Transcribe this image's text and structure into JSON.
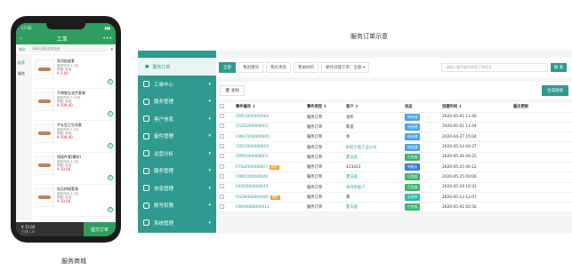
{
  "captions": {
    "left": "服务商城",
    "right": "服务订单示意"
  },
  "phone": {
    "status_time": "17:02",
    "status_right": "▮▮▮",
    "title": "工单",
    "search_tag": "服务",
    "search_placeholder": "请输入服务名称搜索",
    "sidebar": [
      "推荐",
      "服务"
    ],
    "products": [
      {
        "name": "家用插座套",
        "meta1": "服务时间 3-5天",
        "meta2": "规格: 标准",
        "price": "¥ 5.00"
      },
      {
        "name": "不锈钢五金件套装",
        "meta1": "服务时间 7-10天",
        "meta2": "规格: 标准",
        "price": "¥ 599.00"
      },
      {
        "name": "中长型卫生间套",
        "meta1": "服务时间 3-5天",
        "meta2": "规格: 标准",
        "price": "¥ 599.00"
      },
      {
        "name": "锁接件套(螺纹)",
        "meta1": "服务时间 3-5天",
        "meta2": "规格: 标准",
        "price": "¥ 20.00"
      },
      {
        "name": "钻石拼接套装",
        "meta1": "服务时间 3-5天",
        "meta2": "规格: 标准",
        "price": "¥ 50.00"
      }
    ],
    "footer_total": "¥ 15.00",
    "footer_count": "已选 (1)",
    "footer_button": "提交订单"
  },
  "admin": {
    "sidebar_active": "服务订单",
    "nav": [
      {
        "label": "工单中心",
        "icon": "ticket-icon"
      },
      {
        "label": "服务管理",
        "icon": "service-icon"
      },
      {
        "label": "客户信息",
        "icon": "customer-icon"
      },
      {
        "label": "备件管理",
        "icon": "parts-icon"
      },
      {
        "label": "运营分析",
        "icon": "analysis-icon"
      },
      {
        "label": "服务管理",
        "icon": "heart-icon"
      },
      {
        "label": "信息管理",
        "icon": "info-icon"
      },
      {
        "label": "账号权限",
        "icon": "account-icon"
      },
      {
        "label": "系统管理",
        "icon": "settings-icon"
      }
    ],
    "tabs": [
      "全部",
      "我创建的",
      "我负责的",
      "我协同的"
    ],
    "filter_label": "委托创建工单：全部",
    "search_placeholder": "请输入事件编号搜索订单信息",
    "search_button": "搜 索",
    "delete_button": "删除",
    "generate_button": "生成链接",
    "columns": [
      "事件编号 ↕",
      "事件类型 ↕",
      "客户 ↕",
      "状态",
      "创建时间 ↕",
      "最近更新"
    ],
    "rows": [
      {
        "id": "CMR1000000003",
        "type": "服务订单",
        "customer": "张伟",
        "customer_link": false,
        "status": "待处理",
        "status_color": "#4aa3df",
        "created": "2020-05-01 11:46",
        "flag": ""
      },
      {
        "id": "CGZ1000000001",
        "type": "服务订单",
        "customer": "陈莲",
        "customer_link": false,
        "status": "待处理",
        "status_color": "#4aa3df",
        "created": "2020-05-01 11:44",
        "flag": ""
      },
      {
        "id": "CWH7200000005",
        "type": "服务订单",
        "customer": "余",
        "customer_link": false,
        "status": "待处理",
        "status_color": "#4aa3df",
        "created": "2020-04-27 15:04",
        "flag": ""
      },
      {
        "id": "CDD1000000010",
        "type": "服务订单",
        "customer": "彩虹小鱼工业公司",
        "customer_link": true,
        "status": "待处理",
        "status_color": "#4aa3df",
        "created": "2020-05-14 04:27",
        "flag": ""
      },
      {
        "id": "CMP1000000001",
        "type": "服务订单",
        "customer": "夏法庭",
        "customer_link": true,
        "status": "已完成",
        "status_color": "#3cb371",
        "created": "2020-05-26 04:25",
        "flag": ""
      },
      {
        "id": "CYS2000000007",
        "type": "服务订单",
        "customer": "423423",
        "customer_link": false,
        "status": "待报价",
        "status_color": "#3a7bd5",
        "created": "2020-05-25 00:12",
        "flag": "超时"
      },
      {
        "id": "CMP1000000040",
        "type": "服务订单",
        "customer": "夏法庭",
        "customer_link": true,
        "status": "已完成",
        "status_color": "#3cb371",
        "created": "2020-05-25 00:06",
        "flag": ""
      },
      {
        "id": "CKQ0000000010",
        "type": "服务订单",
        "customer": "海河的客户",
        "customer_link": true,
        "status": "已完成",
        "status_color": "#3cb371",
        "created": "2020-05-19 10:31",
        "flag": ""
      },
      {
        "id": "CGD0000000005",
        "type": "服务订单",
        "customer": "我",
        "customer_link": false,
        "status": "处理中",
        "status_color": "#2eb8a0",
        "created": "2020-05-13 12:07",
        "flag": "超时"
      },
      {
        "id": "CWH0000000011",
        "type": "服务订单",
        "customer": "夏法庭",
        "customer_link": true,
        "status": "已完成",
        "status_color": "#3cb371",
        "created": "2020-05-01 02:56",
        "flag": ""
      }
    ]
  }
}
